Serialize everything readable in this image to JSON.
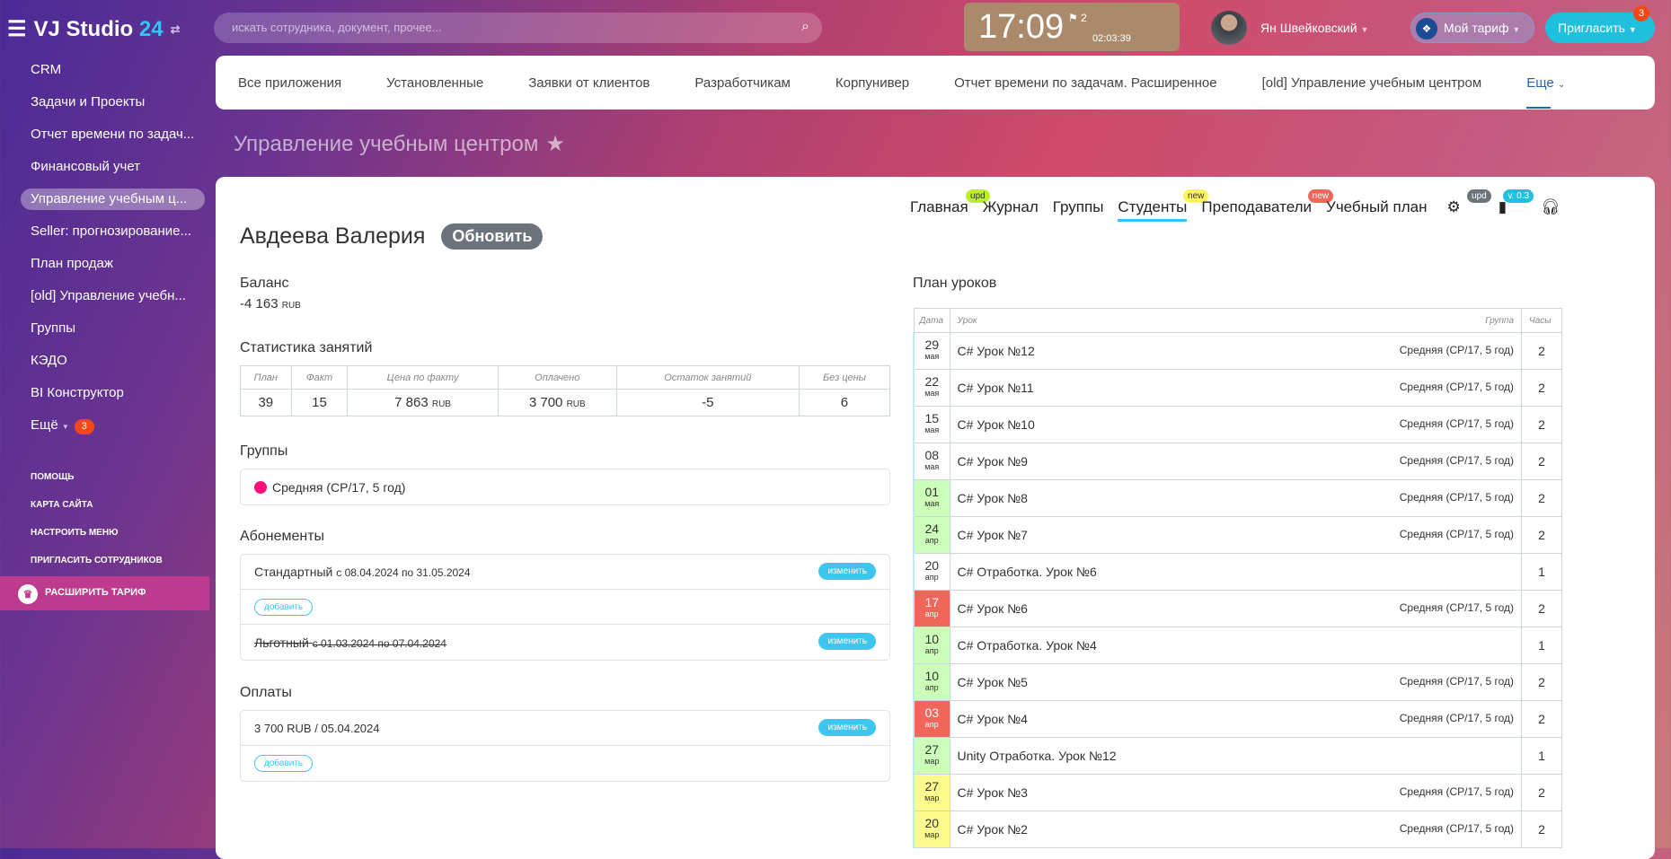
{
  "header": {
    "logo": "VJ Studio",
    "logo_num": "24",
    "search_placeholder": "искать сотрудника, документ, прочее...",
    "time": "17:09",
    "flags": "2",
    "timer": "02:03:39",
    "user": "Ян Швейковский",
    "tariff": "Мой тариф",
    "invite": "Пригласить",
    "invite_badge": "3"
  },
  "sidebar": {
    "items": [
      "CRM",
      "Задачи и Проекты",
      "Отчет времени по задач...",
      "Финансовый учет",
      "Управление учебным ц...",
      "Seller: прогнозирование...",
      "План продаж",
      "[old] Управление учебн...",
      "Группы",
      "КЭДО",
      "BI Конструктор"
    ],
    "more": "Ещё",
    "more_count": "3",
    "links": [
      "ПОМОЩЬ",
      "КАРТА САЙТА",
      "НАСТРОИТЬ МЕНЮ",
      "ПРИГЛАСИТЬ СОТРУДНИКОВ"
    ],
    "upgrade": "РАСШИРИТЬ ТАРИФ"
  },
  "topnav": [
    "Все приложения",
    "Установленные",
    "Заявки от клиентов",
    "Разработчикам",
    "Корпунивер",
    "Отчет времени по задачам. Расширенное",
    "[old] Управление учебным центром"
  ],
  "topnav_more": "Еще",
  "page_title": "Управление учебным центром",
  "tabs": [
    {
      "label": "Главная",
      "badge": "upd"
    },
    {
      "label": "Журнал"
    },
    {
      "label": "Группы"
    },
    {
      "label": "Студенты",
      "badge": "new"
    },
    {
      "label": "Преподаватели",
      "badge": "new"
    },
    {
      "label": "Учебный план"
    }
  ],
  "tab_icons": {
    "settings_badge": "upd",
    "version": "v. 0.3"
  },
  "student": {
    "name": "Авдеева Валерия",
    "refresh": "Обновить"
  },
  "balance": {
    "label": "Баланс",
    "value": "-4 163",
    "currency": "RUB"
  },
  "stats": {
    "label": "Статистика занятий",
    "headers": [
      "План",
      "Факт",
      "Цена по факту",
      "Оплачено",
      "Остаток занятий",
      "Без цены"
    ],
    "values": [
      "39",
      "15",
      "7 863",
      "3 700",
      "-5",
      "6"
    ],
    "currency": "RUB"
  },
  "groups": {
    "label": "Группы",
    "items": [
      "Средняя (СР/17, 5 год)"
    ]
  },
  "subscriptions": {
    "label": "Абонементы",
    "items": [
      {
        "name": "Стандартный",
        "period": "с 08.04.2024 по 31.05.2024"
      },
      {
        "name": "Льготный",
        "period": "с 01.03.2024 по 07.04.2024"
      }
    ],
    "edit": "изменить",
    "add": "добавить"
  },
  "payments": {
    "label": "Оплаты",
    "items": [
      "3 700 RUB / 05.04.2024"
    ]
  },
  "lesson_plan": {
    "label": "План уроков",
    "headers": [
      "Дата",
      "Урок",
      "Группа",
      "Часы"
    ],
    "rows": [
      {
        "day": "29",
        "mon": "мая",
        "lesson": "C# Урок №12",
        "group": "Средняя (СР/17, 5 год)",
        "hours": "2",
        "status": "none"
      },
      {
        "day": "22",
        "mon": "мая",
        "lesson": "C# Урок №11",
        "group": "Средняя (СР/17, 5 год)",
        "hours": "2",
        "status": "none"
      },
      {
        "day": "15",
        "mon": "мая",
        "lesson": "C# Урок №10",
        "group": "Средняя (СР/17, 5 год)",
        "hours": "2",
        "status": "none"
      },
      {
        "day": "08",
        "mon": "мая",
        "lesson": "C# Урок №9",
        "group": "Средняя (СР/17, 5 год)",
        "hours": "2",
        "status": "none"
      },
      {
        "day": "01",
        "mon": "мая",
        "lesson": "C# Урок №8",
        "group": "Средняя (СР/17, 5 год)",
        "hours": "2",
        "status": "present"
      },
      {
        "day": "24",
        "mon": "апр",
        "lesson": "C# Урок №7",
        "group": "Средняя (СР/17, 5 год)",
        "hours": "2",
        "status": "present"
      },
      {
        "day": "20",
        "mon": "апр",
        "lesson": "C# Отработка. Урок №6",
        "group": "",
        "hours": "1",
        "status": "none"
      },
      {
        "day": "17",
        "mon": "апр",
        "lesson": "C# Урок №6",
        "group": "Средняя (СР/17, 5 год)",
        "hours": "2",
        "status": "absent"
      },
      {
        "day": "10",
        "mon": "апр",
        "lesson": "C# Отработка. Урок №4",
        "group": "",
        "hours": "1",
        "status": "present"
      },
      {
        "day": "10",
        "mon": "апр",
        "lesson": "C# Урок №5",
        "group": "Средняя (СР/17, 5 год)",
        "hours": "2",
        "status": "present"
      },
      {
        "day": "03",
        "mon": "апр",
        "lesson": "C# Урок №4",
        "group": "Средняя (СР/17, 5 год)",
        "hours": "2",
        "status": "absent"
      },
      {
        "day": "27",
        "mon": "мар",
        "lesson": "Unity Отработка. Урок №12",
        "group": "",
        "hours": "1",
        "status": "present"
      },
      {
        "day": "27",
        "mon": "мар",
        "lesson": "C# Урок №3",
        "group": "Средняя (СР/17, 5 год)",
        "hours": "2",
        "status": "unpaid"
      },
      {
        "day": "20",
        "mon": "мар",
        "lesson": "C# Урок №2",
        "group": "Средняя (СР/17, 5 год)",
        "hours": "2",
        "status": "unpaid"
      }
    ]
  },
  "colors": {
    "present": "#ccffb8",
    "absent": "#f0675a",
    "unpaid": "#fffa8c",
    "accent": "#2fc6f6"
  }
}
